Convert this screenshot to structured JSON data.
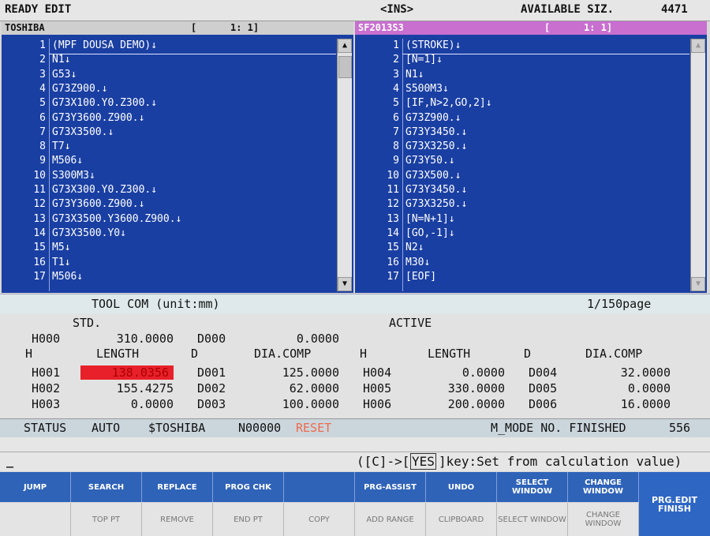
{
  "topbar": {
    "mode": "READY EDIT",
    "ins": "<INS>",
    "avail_label": "AVAILABLE SIZ.",
    "avail_value": "4471"
  },
  "left_pane": {
    "title": "TOSHIBA",
    "bracket_open": "[",
    "position": "1: 1]",
    "lines": [
      {
        "n": "1",
        "t": "(MPF DOUSA DEMO)↓"
      },
      {
        "n": "2",
        "t": "N1↓"
      },
      {
        "n": "3",
        "t": "G53↓"
      },
      {
        "n": "4",
        "t": "G73Z900.↓"
      },
      {
        "n": "5",
        "t": "G73X100.Y0.Z300.↓"
      },
      {
        "n": "6",
        "t": "G73Y3600.Z900.↓"
      },
      {
        "n": "7",
        "t": "G73X3500.↓"
      },
      {
        "n": "8",
        "t": "T7↓"
      },
      {
        "n": "9",
        "t": "M506↓"
      },
      {
        "n": "10",
        "t": "S300M3↓"
      },
      {
        "n": "11",
        "t": "G73X300.Y0.Z300.↓"
      },
      {
        "n": "12",
        "t": "G73Y3600.Z900.↓"
      },
      {
        "n": "13",
        "t": "G73X3500.Y3600.Z900.↓"
      },
      {
        "n": "14",
        "t": "G73X3500.Y0↓"
      },
      {
        "n": "15",
        "t": "M5↓"
      },
      {
        "n": "16",
        "t": "T1↓"
      },
      {
        "n": "17",
        "t": "M506↓"
      }
    ]
  },
  "right_pane": {
    "title": "SF2013S3",
    "bracket_open": "[",
    "position": "1: 1]",
    "lines": [
      {
        "n": "1",
        "t": "(STROKE)↓"
      },
      {
        "n": "2",
        "t": "[N=1]↓"
      },
      {
        "n": "3",
        "t": "N1↓"
      },
      {
        "n": "4",
        "t": "S500M3↓"
      },
      {
        "n": "5",
        "t": "[IF,N>2,GO,2]↓"
      },
      {
        "n": "6",
        "t": "G73Z900.↓"
      },
      {
        "n": "7",
        "t": "G73Y3450.↓"
      },
      {
        "n": "8",
        "t": "G73X3250.↓"
      },
      {
        "n": "9",
        "t": "G73Y50.↓"
      },
      {
        "n": "10",
        "t": "G73X500.↓"
      },
      {
        "n": "11",
        "t": "G73Y3450.↓"
      },
      {
        "n": "12",
        "t": "G73X3250.↓"
      },
      {
        "n": "13",
        "t": "[N=N+1]↓"
      },
      {
        "n": "14",
        "t": "[GO,-1]↓"
      },
      {
        "n": "15",
        "t": "N2↓"
      },
      {
        "n": "16",
        "t": "M30↓"
      },
      {
        "n": "17",
        "t": "[EOF]"
      }
    ]
  },
  "tool": {
    "title": "TOOL COM (unit:mm)",
    "page": "1/150page",
    "std_label": "STD.",
    "active_label": "ACTIVE",
    "h000": "H000",
    "h000_val": "310.0000",
    "d000": "D000",
    "d000_val": "0.0000",
    "col_h": "H",
    "col_length": "LENGTH",
    "col_d": "D",
    "col_dia": "DIA.COMP",
    "rows_left": [
      {
        "h": "H001",
        "len": "138.0356",
        "d": "D001",
        "dia": "125.0000"
      },
      {
        "h": "H002",
        "len": "155.4275",
        "d": "D002",
        "dia": "62.0000"
      },
      {
        "h": "H003",
        "len": "0.0000",
        "d": "D003",
        "dia": "100.0000"
      }
    ],
    "rows_right": [
      {
        "h": "H004",
        "len": "0.0000",
        "d": "D004",
        "dia": "32.0000"
      },
      {
        "h": "H005",
        "len": "330.0000",
        "d": "D005",
        "dia": "0.0000"
      },
      {
        "h": "H006",
        "len": "200.0000",
        "d": "D006",
        "dia": "16.0000"
      }
    ],
    "highlight_color": "#e8202a"
  },
  "status": {
    "label": "STATUS",
    "mode": "AUTO",
    "prog": "$TOSHIBA",
    "seq": "N00000",
    "reset": "RESET",
    "mmode": "M_MODE NO. FINISHED",
    "mnum": "556"
  },
  "input": {
    "cursor": "_",
    "hint_a": "([C]->[",
    "hint_yes": "YES",
    "hint_b": "]key:Set from calculation value)"
  },
  "softkeys_top": [
    "JUMP",
    "SEARCH",
    "REPLACE",
    "PROG CHK",
    "",
    "PRG-ASSIST",
    "UNDO",
    "SELECT WINDOW",
    "CHANGE WINDOW"
  ],
  "softkeys_bottom": [
    "",
    "TOP PT",
    "REMOVE",
    "END PT",
    "COPY",
    "ADD RANGE",
    "CLIPBOARD",
    "SELECT WINDOW",
    "CHANGE WINDOW"
  ],
  "softkey_finish": "PRG.EDIT FINISH",
  "colors": {
    "code_bg": "#1a3fa3",
    "softkey_bg": "#2f63b8",
    "right_header": "#c86fd0"
  }
}
